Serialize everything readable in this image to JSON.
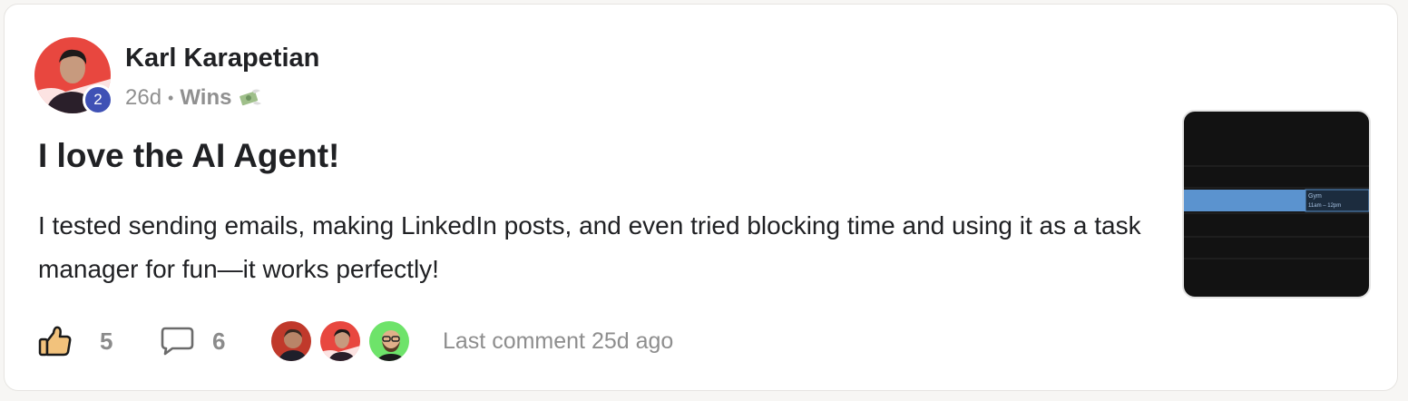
{
  "post": {
    "author": "Karl Karapetian",
    "level": "2",
    "age": "26d",
    "separator": "•",
    "category": "Wins",
    "category_icon": "money-with-wings-icon",
    "title": "I love the AI Agent!",
    "body": "I tested sending emails, making LinkedIn posts, and even tried blocking time and using it as a task manager for fun—it works perfectly!",
    "thumbnail": {
      "event_title": "Gym",
      "event_time": "11am – 12pm"
    }
  },
  "footer": {
    "likes": "5",
    "comments": "6",
    "last_comment": "Last comment 25d ago"
  },
  "colors": {
    "level_badge": "#3f51b5",
    "avatar_bg": "#e8473f",
    "event_block": "#5b93cf"
  }
}
